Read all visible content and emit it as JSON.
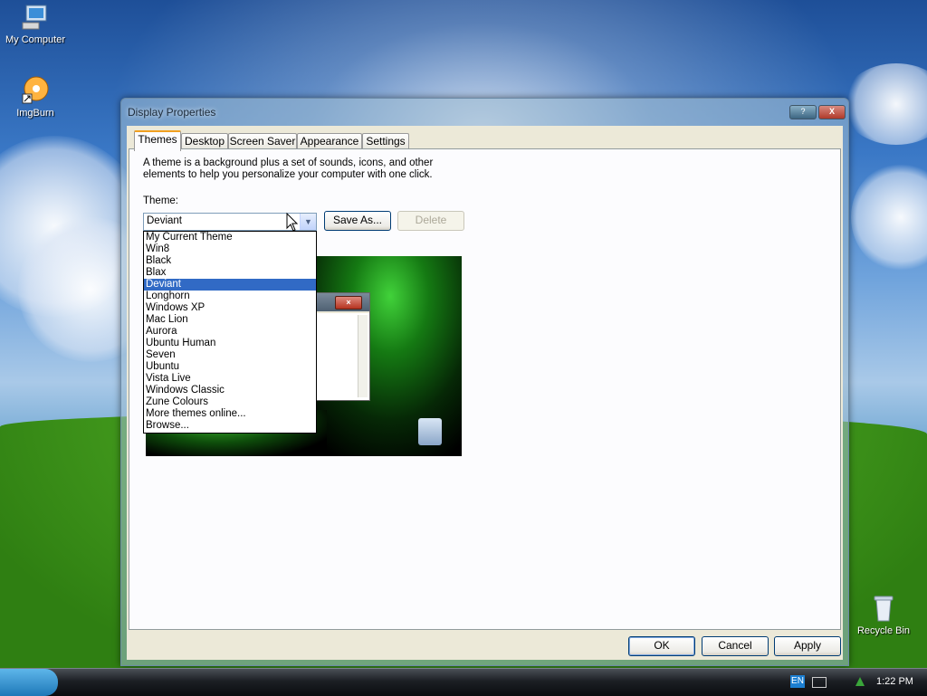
{
  "desktop": {
    "icons": [
      {
        "label": "My Computer"
      },
      {
        "label": "ImgBurn"
      },
      {
        "label": "Recycle Bin"
      }
    ]
  },
  "window": {
    "title": "Display Properties",
    "help_btn": "?",
    "close_btn": "X",
    "tabs": [
      "Themes",
      "Desktop",
      "Screen Saver",
      "Appearance",
      "Settings"
    ],
    "active_tab": "Themes",
    "description": "A theme is a background plus a set of sounds, icons, and other elements to help you personalize your computer with one click.",
    "theme_label": "Theme:",
    "theme_value": "Deviant",
    "save_as": "Save As...",
    "delete": "Delete",
    "dropdown_items": [
      "My Current Theme",
      "Win8",
      "Black",
      "Blax",
      "Deviant",
      "Longhorn",
      "Windows XP",
      "Mac Lion",
      "Aurora",
      "Ubuntu Human",
      "Seven",
      "Ubuntu",
      "Vista Live",
      "Windows Classic",
      "Zune Colours",
      "More themes online...",
      "Browse..."
    ],
    "selected_item": "Deviant",
    "ok": "OK",
    "cancel": "Cancel",
    "apply": "Apply"
  },
  "taskbar": {
    "lang": "EN",
    "clock": "1:22 PM"
  },
  "colors": {
    "selection": "#316ac5",
    "dialog_bg": "#ece9d8",
    "tab_accent": "#f0a020"
  }
}
